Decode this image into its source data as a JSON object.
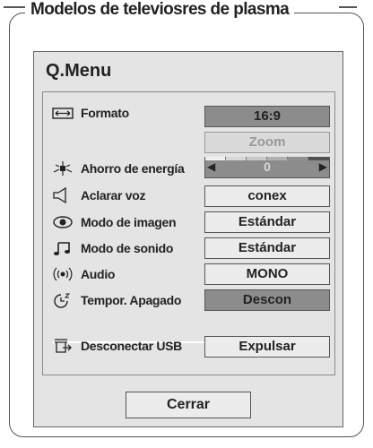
{
  "heading": "Modelos de televiosres de plasma",
  "menu": {
    "title": "Q.Menu",
    "rows": [
      {
        "label": "Formato",
        "value": "16:9",
        "icon": "aspect-ratio-icon"
      },
      {
        "label": "",
        "value": "Zoom",
        "icon": ""
      },
      {
        "label": "Ahorro de energía",
        "value": "0",
        "icon": "energy-saving-icon"
      },
      {
        "label": "Aclarar voz",
        "value": "conex",
        "icon": "clear-voice-icon"
      },
      {
        "label": "Modo de imagen",
        "value": "Estándar",
        "icon": "picture-mode-icon"
      },
      {
        "label": "Modo de sonido",
        "value": "Estándar",
        "icon": "music-note-icon"
      },
      {
        "label": "Audio",
        "value": "MONO",
        "icon": "audio-icon"
      },
      {
        "label": "Tempor. Apagado",
        "value": "Descon",
        "icon": "sleep-timer-icon"
      },
      {
        "label": "Desconectar USB",
        "value": "Expulsar",
        "icon": "usb-eject-icon"
      }
    ],
    "close_label": "Cerrar"
  },
  "colors": {
    "selected": "#8c8c8c",
    "panel": "#e4e4e4",
    "value_bg": "#ececec"
  }
}
